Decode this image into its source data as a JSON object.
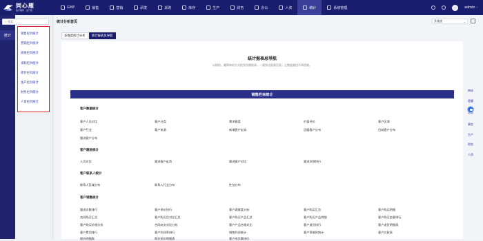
{
  "app": {
    "name": "同心雁",
    "subtitle": "数字雁阵 · 生产圈"
  },
  "nav": [
    {
      "label": "GMP",
      "icon": "gmp-icon",
      "active": false
    },
    {
      "label": "销售",
      "icon": "sales-icon",
      "active": false
    },
    {
      "label": "营销",
      "icon": "marketing-icon",
      "active": false
    },
    {
      "label": "研发",
      "icon": "rnd-icon",
      "active": false
    },
    {
      "label": "采购",
      "icon": "purchase-icon",
      "active": false
    },
    {
      "label": "库存",
      "icon": "inventory-icon",
      "active": false
    },
    {
      "label": "生产",
      "icon": "production-icon",
      "active": false
    },
    {
      "label": "财务",
      "icon": "finance-icon",
      "active": false
    },
    {
      "label": "办公",
      "icon": "office-icon",
      "active": false
    },
    {
      "label": "人资",
      "icon": "hr-icon",
      "active": false
    },
    {
      "label": "统计",
      "icon": "stats-icon",
      "active": true
    },
    {
      "label": "系统管理",
      "icon": "settings-icon",
      "active": false
    }
  ],
  "user": {
    "name": "admin -"
  },
  "sidebar": {
    "active_label": "统计"
  },
  "search": {
    "placeholder": "搜索"
  },
  "menu": [
    "销售栏目统计",
    "营销栏目统计",
    "研发栏目统计",
    "采购栏目统计",
    "库存栏目统计",
    "生产栏目统计",
    "财务栏目统计",
    "人资栏目统计"
  ],
  "main": {
    "title": "统计分析首页",
    "range": "多维度",
    "tabs": [
      "多维度统计分析",
      "统计报表总导航"
    ]
  },
  "card": {
    "title": "统计报表总导航",
    "subtitle": "以模块，最简单的方式找到所需报表，一键到达报表页面，让数据查找不再困难。",
    "banner": "销售栏目统计",
    "groups": [
      {
        "title": "客户数据统计",
        "links": [
          "客户人员对比",
          "客户分类",
          "需求额度",
          "价值评价",
          "客户区域",
          "客户行业",
          "客户来源",
          "新增客户走势",
          "回暖客户分布",
          "目前客户分布",
          "跟进客户分布"
        ]
      },
      {
        "title": "客户跟进统计",
        "links": [
          "人员对比",
          "跟进客户走势",
          "跟进客户对比",
          "跟进次数排行"
        ]
      },
      {
        "title": "客户联系人统计",
        "links": [
          "联系人区域分布",
          "联系人行业分布",
          "性别分布"
        ]
      },
      {
        "title": "客户销售统计",
        "links": [
          "跟进次数排行",
          "客户采价排行",
          "客户满意度分析",
          "客户购买汇总",
          "客户购买明细",
          "合同购买汇总",
          "客户购买月对比汇总",
          "客户购买产品汇总",
          "客户购买产品明细",
          "客户购买金额排行",
          "客户购买价格分析",
          "合同成交对比分析",
          "客户产品合格对比",
          "客户退货排行",
          "客户退货明细表",
          "客户费用排行",
          "客户利润率排行",
          "销售利润统计",
          "客户预收款统计",
          "客户欠款表",
          "报价明细表",
          "报价折扣明细表",
          "客户成交额排行"
        ]
      }
    ]
  },
  "dock": [
    "审核",
    "提醒",
    "消息",
    "事务",
    "生产",
    "财务",
    "人资"
  ]
}
